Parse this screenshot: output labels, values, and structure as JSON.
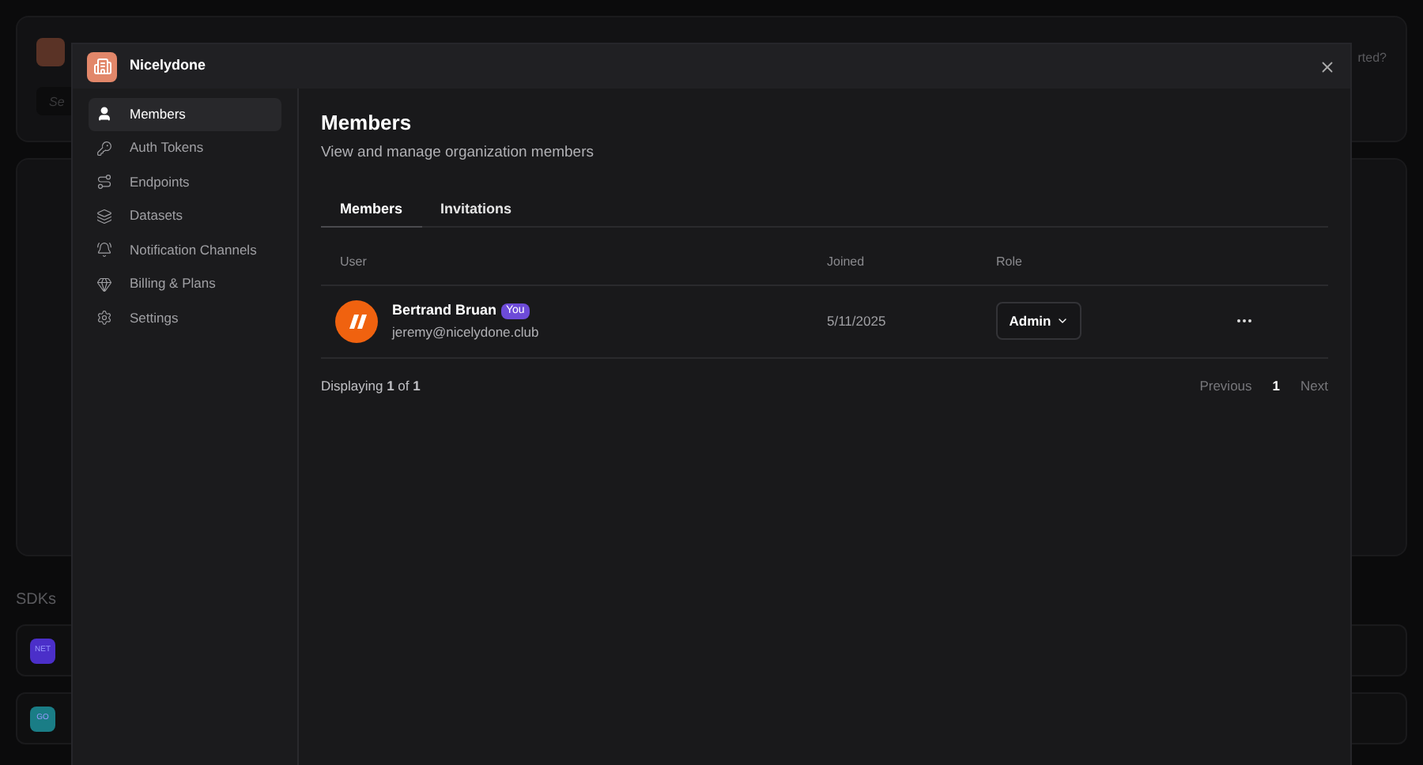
{
  "background": {
    "header_text": "rted?",
    "search": {
      "placeholder": "Se"
    },
    "sdks_heading": "SDKs",
    "sdks": [
      {
        "label": "NET",
        "color": "#4b2fc9"
      },
      {
        "label": "GO",
        "color": "#1a7d86"
      }
    ]
  },
  "modal": {
    "org_name": "Nicelydone",
    "sidebar": {
      "items": [
        {
          "label": "Members",
          "selected": true
        },
        {
          "label": "Auth Tokens",
          "selected": false
        },
        {
          "label": "Endpoints",
          "selected": false
        },
        {
          "label": "Datasets",
          "selected": false
        },
        {
          "label": "Notification Channels",
          "selected": false
        },
        {
          "label": "Billing & Plans",
          "selected": false
        },
        {
          "label": "Settings",
          "selected": false
        }
      ]
    },
    "title": "Members",
    "subtitle": "View and manage organization members",
    "tabs": [
      {
        "label": "Members",
        "selected": true
      },
      {
        "label": "Invitations",
        "selected": false
      }
    ],
    "table": {
      "columns": [
        "User",
        "Joined",
        "Role"
      ],
      "rows": [
        {
          "name": "Bertrand Bruan",
          "badge": "You",
          "email": "jeremy@nicelydone.club",
          "joined": "5/11/2025",
          "role": "Admin"
        }
      ]
    },
    "footer": {
      "displaying": "Displaying **1** of **1**",
      "previous": "Previous",
      "page": "1",
      "next": "Next"
    }
  }
}
